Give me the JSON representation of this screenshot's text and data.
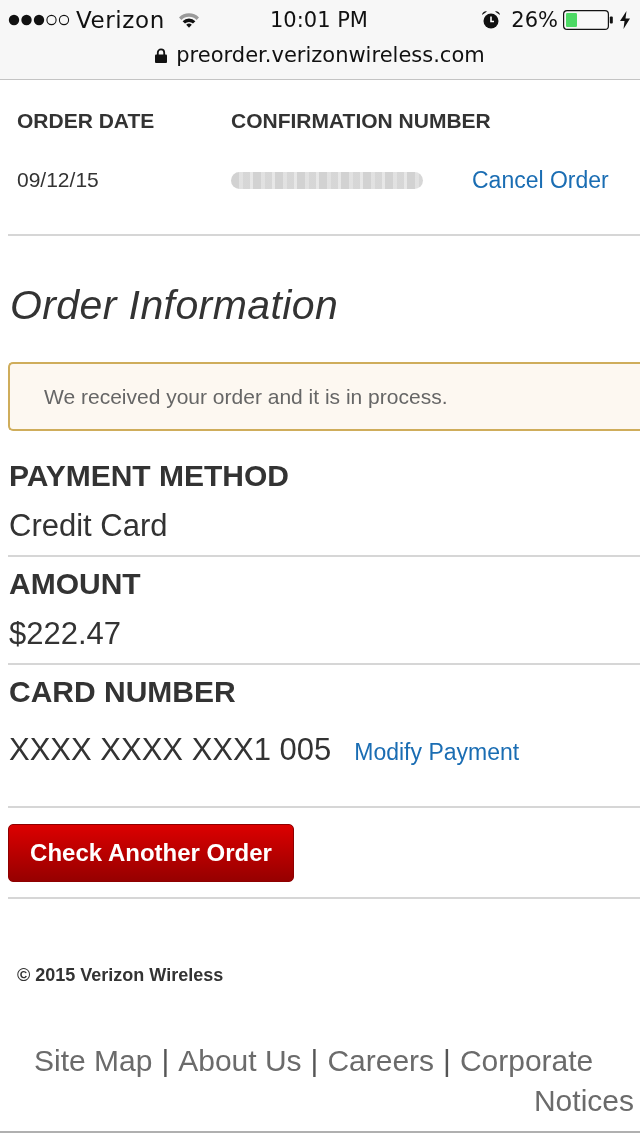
{
  "status_bar": {
    "carrier": "Verizon",
    "time": "10:01 PM",
    "battery": "26%",
    "url": "preorder.verizonwireless.com"
  },
  "order_header": {
    "columns": [
      "ORDER DATE",
      "CONFIRMATION NUMBER"
    ],
    "order_date": "09/12/15",
    "confirmation_number": {
      "redacted": true
    },
    "cancel_link": "Cancel Order"
  },
  "order_information": {
    "title": "Order Information",
    "notice": "We received your order and it is in process.",
    "fields": [
      {
        "label": "PAYMENT METHOD",
        "value": "Credit Card"
      },
      {
        "label": "AMOUNT",
        "value": "$222.47"
      },
      {
        "label": "CARD NUMBER",
        "value": "XXXX XXXX XXX1 005",
        "link": "Modify Payment"
      }
    ]
  },
  "button": "Check Another Order",
  "footer": {
    "copyright": "© 2015 Verizon Wireless",
    "line_1": [
      {
        "kind": "link",
        "text": "Site Map"
      },
      {
        "kind": "separator",
        "text": "|"
      },
      {
        "kind": "link",
        "text": "About Us"
      },
      {
        "kind": "separator",
        "text": "|"
      },
      {
        "kind": "link",
        "text": "Careers"
      },
      {
        "kind": "separator",
        "text": "|"
      },
      {
        "kind": "link",
        "text": "Corporate"
      }
    ],
    "line_2": [
      {
        "kind": "link",
        "text": "Notices"
      }
    ]
  }
}
